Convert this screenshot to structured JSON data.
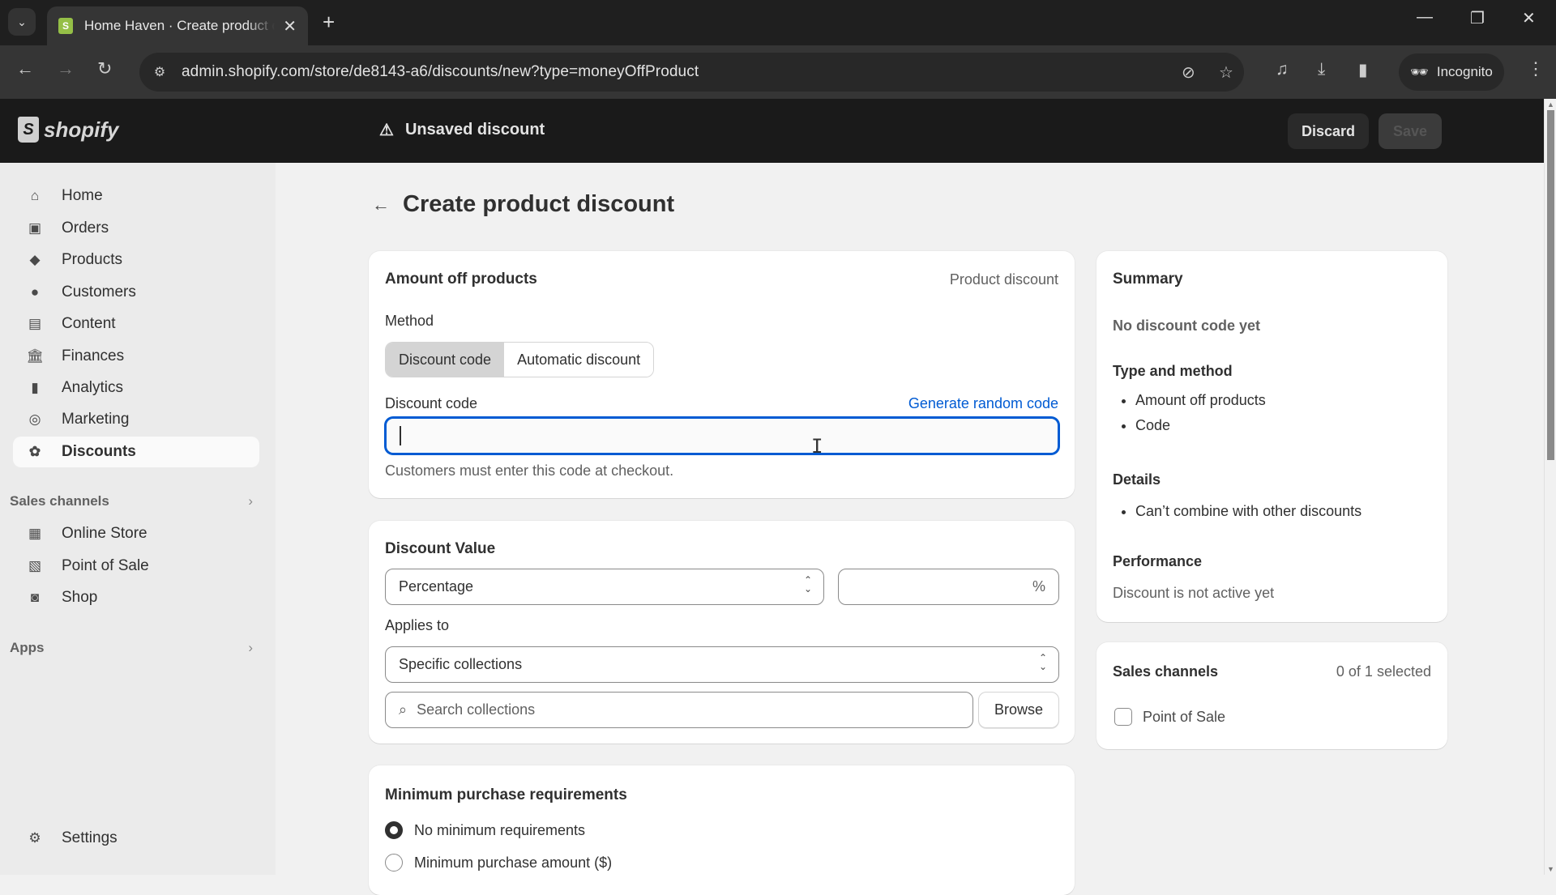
{
  "browser": {
    "tab_title": "Home Haven · Create product discount",
    "url": "admin.shopify.com/store/de8143-a6/discounts/new?type=moneyOffProduct",
    "incognito_label": "Incognito"
  },
  "header": {
    "logo_text": "shopify",
    "status_text": "Unsaved discount",
    "discard_label": "Discard",
    "save_label": "Save"
  },
  "sidebar": {
    "items": [
      {
        "label": "Home",
        "icon": "home-icon"
      },
      {
        "label": "Orders",
        "icon": "orders-icon"
      },
      {
        "label": "Products",
        "icon": "tag-icon"
      },
      {
        "label": "Customers",
        "icon": "person-icon"
      },
      {
        "label": "Content",
        "icon": "content-icon"
      },
      {
        "label": "Finances",
        "icon": "bank-icon"
      },
      {
        "label": "Analytics",
        "icon": "bar-chart-icon"
      },
      {
        "label": "Marketing",
        "icon": "target-icon"
      },
      {
        "label": "Discounts",
        "icon": "discount-icon",
        "active": true
      }
    ],
    "sales_channels_label": "Sales channels",
    "sales_channels": [
      {
        "label": "Online Store",
        "icon": "store-icon"
      },
      {
        "label": "Point of Sale",
        "icon": "pos-icon"
      },
      {
        "label": "Shop",
        "icon": "shop-icon"
      }
    ],
    "apps_label": "Apps",
    "settings_label": "Settings"
  },
  "page": {
    "title": "Create product discount"
  },
  "method_card": {
    "title": "Amount off products",
    "type_label": "Product discount",
    "method_label": "Method",
    "method_options": [
      "Discount code",
      "Automatic discount"
    ],
    "selected_method": "Discount code",
    "code_label": "Discount code",
    "generate_link": "Generate random code",
    "code_value": "",
    "help_text": "Customers must enter this code at checkout."
  },
  "value_card": {
    "title": "Discount Value",
    "value_type": "Percentage",
    "value_amount": "",
    "value_suffix": "%",
    "applies_label": "Applies to",
    "applies_value": "Specific collections",
    "search_placeholder": "Search collections",
    "browse_label": "Browse"
  },
  "min_card": {
    "title": "Minimum purchase requirements",
    "options": [
      "No minimum requirements",
      "Minimum purchase amount ($)"
    ],
    "selected": "No minimum requirements"
  },
  "summary": {
    "title": "Summary",
    "code_status": "No discount code yet",
    "type_heading": "Type and method",
    "type_items": [
      "Amount off products",
      "Code"
    ],
    "details_heading": "Details",
    "details_items": [
      "Can’t combine with other discounts"
    ],
    "performance_heading": "Performance",
    "performance_text": "Discount is not active yet"
  },
  "channels_card": {
    "title": "Sales channels",
    "count_text": "0 of 1 selected",
    "options": [
      {
        "label": "Point of Sale",
        "checked": false
      }
    ]
  }
}
